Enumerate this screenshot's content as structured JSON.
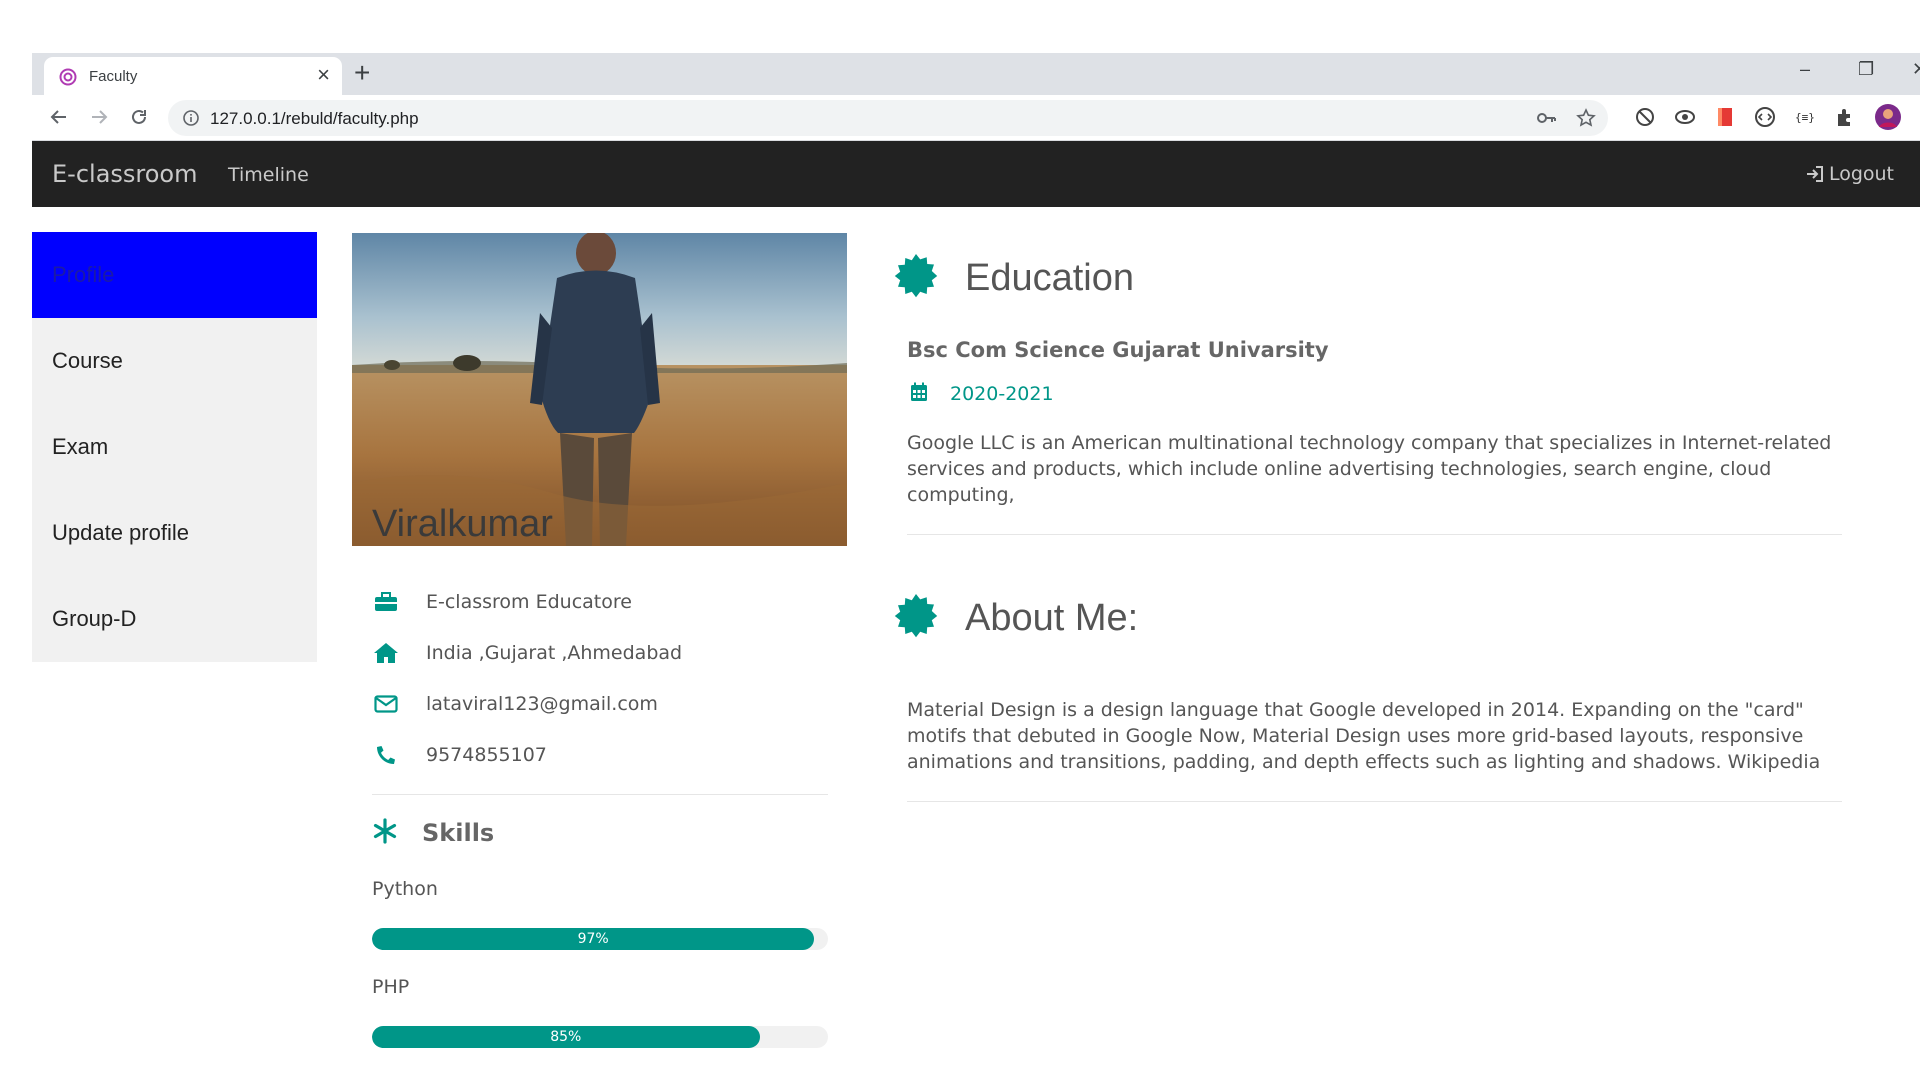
{
  "browser": {
    "tab_title": "Faculty",
    "tab_close": "×",
    "new_tab": "+",
    "url": "127.0.0.1/rebuld/faculty.php",
    "window_controls": {
      "minimize": "–",
      "restore": "❐",
      "close": "✕"
    }
  },
  "navbar": {
    "brand": "E-classroom",
    "links": [
      {
        "label": "Timeline"
      }
    ],
    "logout_label": "Logout"
  },
  "sidebar": {
    "items": [
      {
        "label": "Profile",
        "active": true
      },
      {
        "label": "Course"
      },
      {
        "label": "Exam"
      },
      {
        "label": "Update profile"
      },
      {
        "label": "Group-D"
      }
    ]
  },
  "profile": {
    "name": "Viralkumar",
    "info": [
      {
        "icon": "briefcase-icon",
        "text": "E-classrom Educatore"
      },
      {
        "icon": "home-icon",
        "text": "India ,Gujarat ,Ahmedabad"
      },
      {
        "icon": "envelope-icon",
        "text": "lataviral123@gmail.com"
      },
      {
        "icon": "phone-icon",
        "text": "9574855107"
      }
    ],
    "skills_title": "Skills",
    "skills": [
      {
        "name": "Python",
        "percent": 97,
        "label": "97%"
      },
      {
        "name": "PHP",
        "percent": 85,
        "label": "85%"
      }
    ]
  },
  "education": {
    "title": "Education",
    "degree": "Bsc Com Science Gujarat Univarsity",
    "years": "2020-2021",
    "description": "Google LLC is an American multinational technology company that specializes in Internet-related services and products, which include online advertising technologies, search engine, cloud computing,"
  },
  "about": {
    "title": "About Me:",
    "description": "Material Design is a design language that Google developed in 2014. Expanding on the \"card\" motifs that debuted in Google Now, Material Design uses more grid-based layouts, responsive animations and transitions, padding, and depth effects such as lighting and shadows. Wikipedia"
  },
  "colors": {
    "accent": "#009688",
    "navbar": "#222222",
    "sidebar_active": "#0000ff",
    "sidebar_bg": "#f1f1f1"
  }
}
